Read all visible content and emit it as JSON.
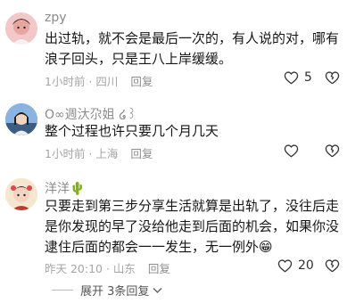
{
  "comments": [
    {
      "username": "zpy",
      "text": "出过轨，就不会是最后一次的，有人说的对，哪有浪子回头，只是王八上岸缓缓。",
      "time": "1小时前",
      "location": "四川",
      "reply_label": "回复",
      "likes": "5"
    },
    {
      "username": "O∞週汏尕姐 ໒꒱",
      "text": "整个过程也许只要几个月几天",
      "time": "1小时前",
      "location": "上海",
      "reply_label": "回复",
      "likes": ""
    },
    {
      "username": "洋洋🌵",
      "text": "只要走到第三步分享生活就算是出轨了，没往后走是你发现的早了没给他走到后面的机会，如果你没逮住后面的都会一一发生，无一例外😁",
      "time": "昨天 20:10",
      "location": "山东",
      "reply_label": "回复",
      "likes": "20"
    }
  ],
  "expand_replies": "展开 3条回复"
}
